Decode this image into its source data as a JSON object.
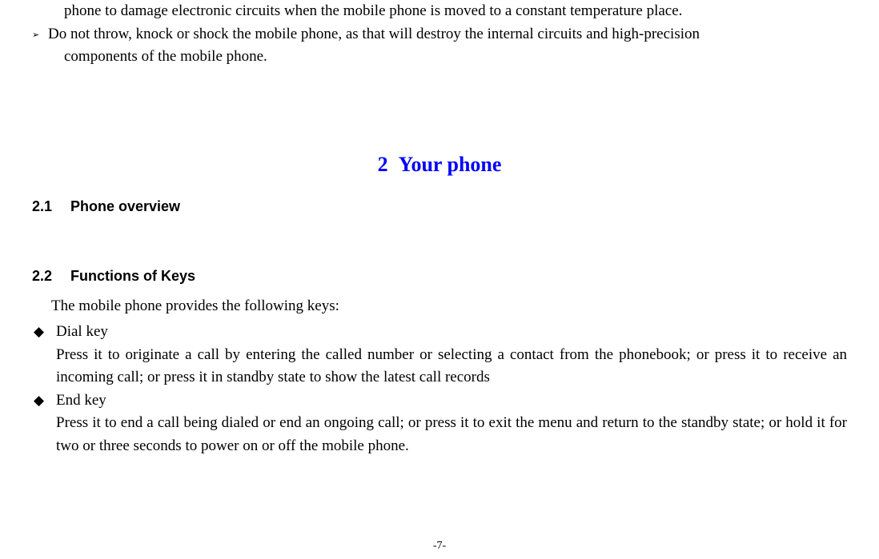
{
  "prevPage": {
    "continuation": "phone to damage electronic circuits when the mobile phone is moved to a constant temperature place.",
    "bulletStart": "Do not throw, knock or shock the mobile phone, as that will destroy the internal circuits and high-precision",
    "bulletCont": "components of the mobile phone."
  },
  "chapter": {
    "number": "2",
    "title": "Your phone"
  },
  "section21": {
    "number": "2.1",
    "title": "Phone overview"
  },
  "section22": {
    "number": "2.2",
    "title": "Functions of Keys",
    "intro": "The mobile phone provides the following keys:",
    "items": [
      {
        "name": "Dial key",
        "desc": "Press it to originate a call by entering the called number or selecting a contact from the phonebook; or press it to receive an incoming call; or press it in standby state to show the latest call records"
      },
      {
        "name": "End key",
        "desc": "Press it to end a call being dialed or end an ongoing call; or press it to exit the menu and return to the standby state; or hold it for two or three seconds to power on or off the mobile phone."
      }
    ]
  },
  "pageNumber": "-7-"
}
